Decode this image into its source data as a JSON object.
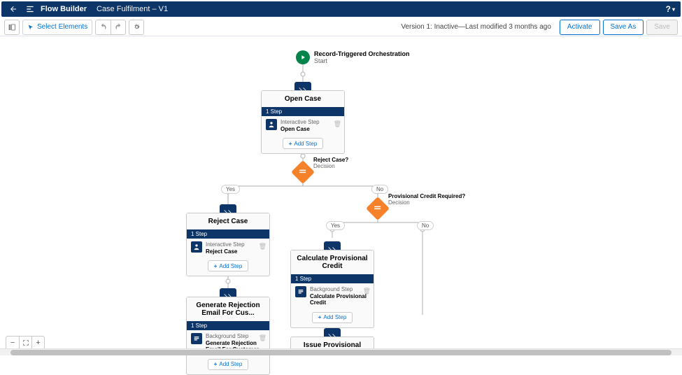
{
  "header": {
    "app": "Flow Builder",
    "title": "Case Fulfilment – V1",
    "help": "?",
    "help_caret": "▾"
  },
  "toolbar": {
    "select_elements": "Select Elements",
    "status": "Version 1: Inactive—Last modified 3 months ago",
    "activate": "Activate",
    "save_as": "Save As",
    "save": "Save"
  },
  "start": {
    "type": "Record-Triggered Orchestration",
    "action": "Start"
  },
  "stages": {
    "open_case": {
      "title": "Open Case",
      "badge": "1 Step",
      "step_src": "Interactive Step",
      "step_name": "Open Case",
      "add": "Add Step"
    },
    "reject_case": {
      "title": "Reject Case",
      "badge": "1 Step",
      "step_src": "Interactive Step",
      "step_name": "Reject Case",
      "add": "Add Step"
    },
    "gen_rejection": {
      "title": "Generate Rejection Email For Cus...",
      "badge": "1 Step",
      "step_src": "Background Step",
      "step_name": "Generate Rejection Email For Customer",
      "add": "Add Step"
    },
    "calc_credit": {
      "title": "Calculate Provisional Credit",
      "badge": "1 Step",
      "step_src": "Background Step",
      "step_name": "Calculate Provisional Credit",
      "add": "Add Step"
    },
    "issue_credit": {
      "title": "Issue Provisional Credit"
    }
  },
  "decisions": {
    "reject_case": {
      "title": "Reject Case?",
      "sub": "Decision",
      "yes": "Yes",
      "no": "No"
    },
    "prov_credit": {
      "title": "Provisional Credit Required?",
      "sub": "Decision",
      "yes": "Yes",
      "no": "No"
    }
  },
  "chart_data": {
    "type": "flow",
    "nodes": [
      {
        "id": "start",
        "kind": "start",
        "label": "Record-Triggered Orchestration – Start"
      },
      {
        "id": "open_case",
        "kind": "stage",
        "label": "Open Case",
        "steps": [
          {
            "type": "Interactive Step",
            "name": "Open Case"
          }
        ]
      },
      {
        "id": "d_reject",
        "kind": "decision",
        "label": "Reject Case?"
      },
      {
        "id": "reject_case",
        "kind": "stage",
        "label": "Reject Case",
        "steps": [
          {
            "type": "Interactive Step",
            "name": "Reject Case"
          }
        ]
      },
      {
        "id": "gen_rejection",
        "kind": "stage",
        "label": "Generate Rejection Email For Customer",
        "steps": [
          {
            "type": "Background Step",
            "name": "Generate Rejection Email For Customer"
          }
        ]
      },
      {
        "id": "d_credit",
        "kind": "decision",
        "label": "Provisional Credit Required?"
      },
      {
        "id": "calc_credit",
        "kind": "stage",
        "label": "Calculate Provisional Credit",
        "steps": [
          {
            "type": "Background Step",
            "name": "Calculate Provisional Credit"
          }
        ]
      },
      {
        "id": "issue_credit",
        "kind": "stage",
        "label": "Issue Provisional Credit"
      }
    ],
    "edges": [
      {
        "from": "start",
        "to": "open_case"
      },
      {
        "from": "open_case",
        "to": "d_reject"
      },
      {
        "from": "d_reject",
        "to": "reject_case",
        "label": "Yes"
      },
      {
        "from": "d_reject",
        "to": "d_credit",
        "label": "No"
      },
      {
        "from": "reject_case",
        "to": "gen_rejection"
      },
      {
        "from": "d_credit",
        "to": "calc_credit",
        "label": "Yes"
      },
      {
        "from": "d_credit",
        "to": "(continue right)",
        "label": "No"
      },
      {
        "from": "calc_credit",
        "to": "issue_credit"
      }
    ]
  }
}
